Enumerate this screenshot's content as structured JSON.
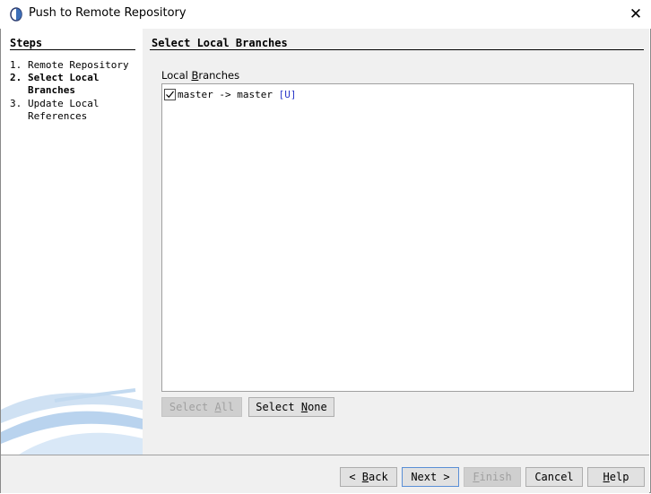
{
  "window": {
    "title": "Push to Remote Repository",
    "close_glyph": "✕"
  },
  "steps": {
    "header": "Steps",
    "items": [
      {
        "num": "1.",
        "label": "Remote Repository"
      },
      {
        "num": "2.",
        "label": "Select Local Branches"
      },
      {
        "num": "3.",
        "label": "Update Local References"
      }
    ]
  },
  "main": {
    "header": "Select Local Branches",
    "field_label_pre": "Local ",
    "field_label_mn": "B",
    "field_label_post": "ranches",
    "branches": [
      {
        "name": "master -> master",
        "tag": "[U]",
        "checked": true
      }
    ],
    "select_all": {
      "pre": "Select ",
      "mn": "A",
      "post": "ll"
    },
    "select_none": {
      "pre": "Select ",
      "mn": "N",
      "post": "one"
    }
  },
  "footer": {
    "back": {
      "pre": "< ",
      "mn": "B",
      "post": "ack"
    },
    "next": {
      "label": "Next >"
    },
    "finish": {
      "mn": "F",
      "post": "inish"
    },
    "cancel": {
      "label": "Cancel"
    },
    "help": {
      "mn": "H",
      "post": "elp"
    }
  }
}
